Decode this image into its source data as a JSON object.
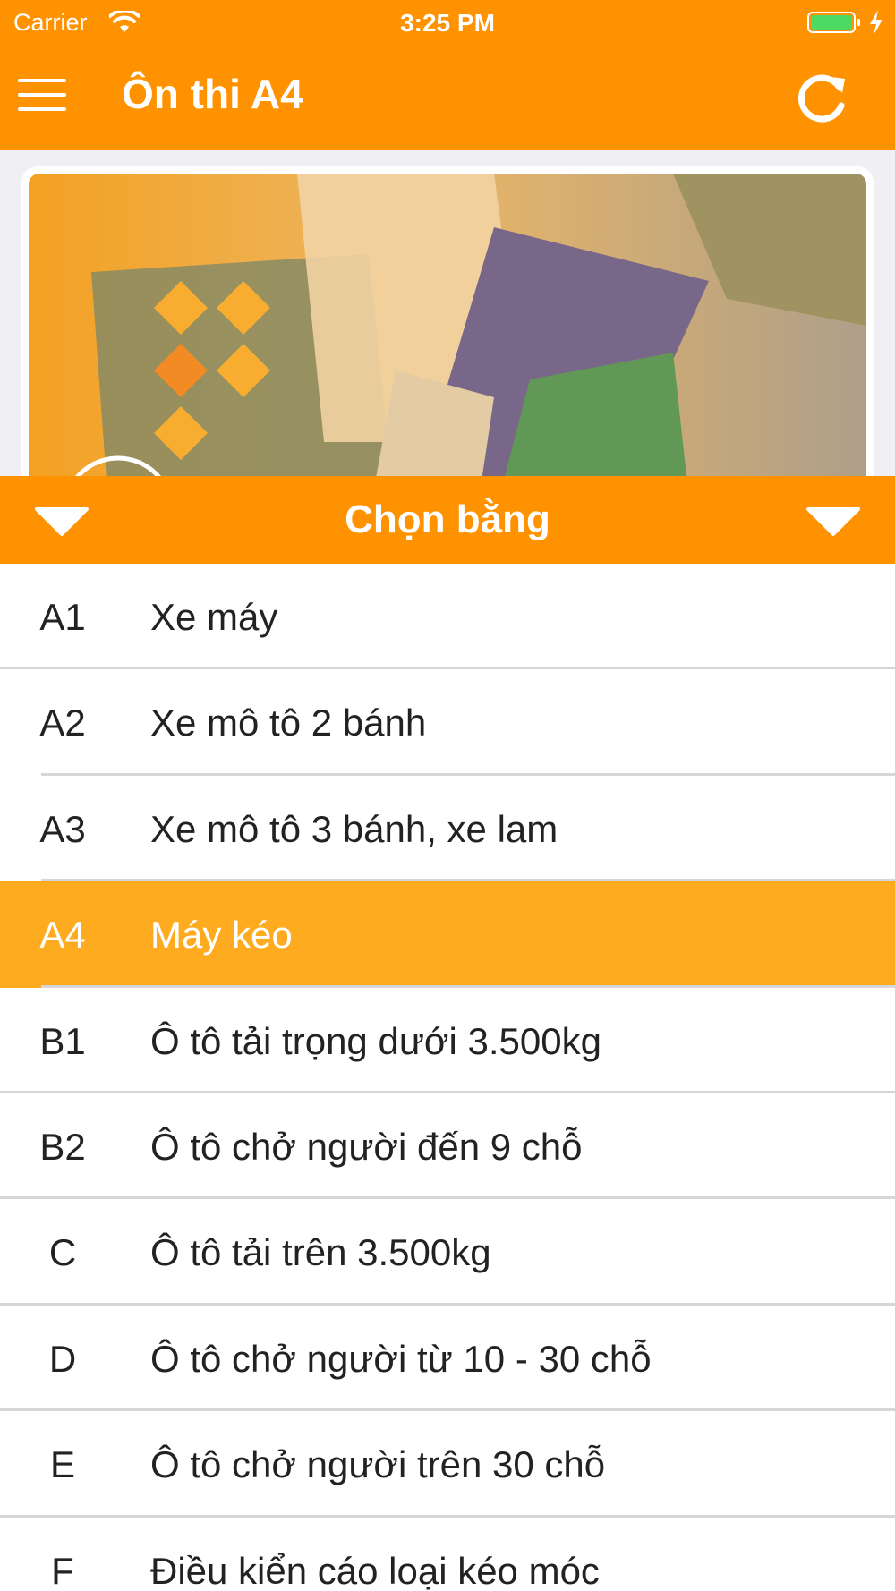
{
  "status_bar": {
    "carrier": "Carrier",
    "time": "3:25 PM",
    "icons": [
      "wifi-icon",
      "battery-icon",
      "charging-bolt-icon"
    ]
  },
  "nav_bar": {
    "title": "Ôn thi A4",
    "left_icon": "menu-icon",
    "right_icon": "refresh-icon"
  },
  "picker": {
    "title": "Chọn bằng",
    "left_icon": "chevron-down-icon",
    "right_icon": "chevron-down-icon"
  },
  "licenses": [
    {
      "code": "A1",
      "desc": "Xe máy"
    },
    {
      "code": "A2",
      "desc": "Xe mô tô 2 bánh"
    },
    {
      "code": "A3",
      "desc": "Xe mô tô 3 bánh, xe lam"
    },
    {
      "code": "A4",
      "desc": "Máy kéo"
    },
    {
      "code": "B1",
      "desc": "Ô tô tải trọng dưới 3.500kg"
    },
    {
      "code": "B2",
      "desc": "Ô tô chở người đến 9 chỗ"
    },
    {
      "code": "C",
      "desc": "Ô tô tải trên 3.500kg"
    },
    {
      "code": "D",
      "desc": "Ô tô chở người từ 10 - 30 chỗ"
    },
    {
      "code": "E",
      "desc": "Ô tô chở người trên 30 chỗ"
    },
    {
      "code": "F",
      "desc": "Điều kiển cáo loại kéo móc"
    }
  ],
  "selected_code": "A4",
  "colors": {
    "primary": "#fe9200",
    "selected_row": "#feab20",
    "text": "#222222"
  }
}
